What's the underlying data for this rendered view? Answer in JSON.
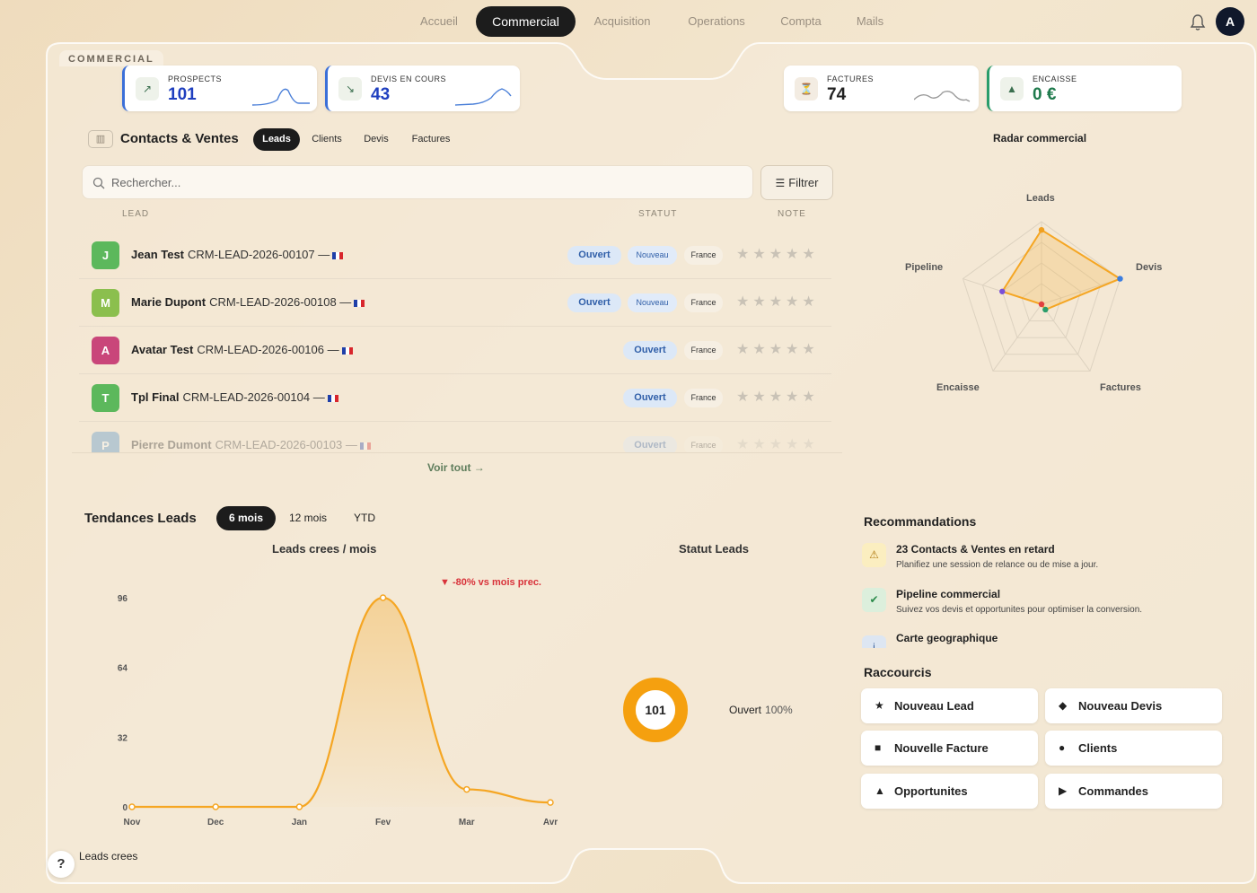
{
  "nav": {
    "tabs": [
      {
        "label": "Accueil"
      },
      {
        "label": "Commercial"
      },
      {
        "label": "Acquisition"
      },
      {
        "label": "Operations"
      },
      {
        "label": "Compta"
      },
      {
        "label": "Mails"
      }
    ],
    "active_tab": "Commercial",
    "avatar_initial": "A",
    "bell_icon": "bell-icon"
  },
  "section_tag": "COMMERCIAL",
  "kpis": [
    {
      "label": "PROSPECTS",
      "value": "101",
      "icon": "trend-up-icon",
      "color": "#1f3fbf"
    },
    {
      "label": "DEVIS EN COURS",
      "value": "43",
      "icon": "trend-down-icon",
      "color": "#1f3fbf"
    },
    {
      "label": "FACTURES",
      "value": "74",
      "icon": "hourglass-icon",
      "color": "#222222"
    },
    {
      "label": "ENCAISSE",
      "value": "0 €",
      "icon": "triangle-icon",
      "color": "#1e7a4c"
    }
  ],
  "contacts": {
    "title": "Contacts & Ventes",
    "tabs": [
      "Leads",
      "Clients",
      "Devis",
      "Factures"
    ],
    "active_tab": "Leads",
    "search_placeholder": "Rechercher...",
    "filter_label": "Filtrer",
    "columns": {
      "lead": "LEAD",
      "statut": "STATUT",
      "note": "NOTE"
    },
    "rows": [
      {
        "initial": "J",
        "color": "#5cb85c",
        "name": "Jean Test",
        "id": "CRM-LEAD-2026-00107 —",
        "status": "Ouvert",
        "tag": "Nouveau",
        "country": "France"
      },
      {
        "initial": "M",
        "color": "#8bbf4e",
        "name": "Marie Dupont",
        "id": "CRM-LEAD-2026-00108 —",
        "status": "Ouvert",
        "tag": "Nouveau",
        "country": "France"
      },
      {
        "initial": "A",
        "color": "#c9467a",
        "name": "Avatar Test",
        "id": "CRM-LEAD-2026-00106 —",
        "status": "Ouvert",
        "tag": "",
        "country": "France"
      },
      {
        "initial": "T",
        "color": "#5cb85c",
        "name": "Tpl Final",
        "id": "CRM-LEAD-2026-00104 —",
        "status": "Ouvert",
        "tag": "",
        "country": "France"
      },
      {
        "initial": "P",
        "color": "#4a8fc9",
        "name": "Pierre Dumont",
        "id": "CRM-LEAD-2026-00103 —",
        "status": "Ouvert",
        "tag": "",
        "country": "France"
      }
    ],
    "stars": "★★★★★",
    "voir_tout": "Voir tout →"
  },
  "radar": {
    "title": "Radar commercial",
    "axes": [
      "Leads",
      "Devis",
      "Factures",
      "Encaisse",
      "Pipeline"
    ],
    "values": [
      0.9,
      1.0,
      0.08,
      0.0,
      0.5
    ],
    "point_colors": [
      "#f0a020",
      "#3b7de0",
      "#2a9d6b",
      "#e04040",
      "#7a4fd8"
    ]
  },
  "trends": {
    "title": "Tendances Leads",
    "tabs": [
      "6 mois",
      "12 mois",
      "YTD"
    ],
    "active_tab": "6 mois",
    "chart_title": "Leads crees / mois",
    "delta": "▼ -80% vs mois prec.",
    "legend": "Leads crees"
  },
  "chart_data": {
    "type": "area",
    "categories": [
      "Nov",
      "Dec",
      "Jan",
      "Fev",
      "Mar",
      "Avr"
    ],
    "series": [
      {
        "name": "Leads crees",
        "values": [
          0,
          0,
          0,
          96,
          8,
          2
        ]
      }
    ],
    "yticks": [
      0,
      32,
      64,
      96
    ],
    "ylim": [
      0,
      96
    ],
    "color": "#f5a623"
  },
  "statut": {
    "title": "Statut Leads",
    "total": "101",
    "label": "Ouvert",
    "pct": "100%",
    "color": "#f5a00f"
  },
  "recommendations": {
    "title": "Recommandations",
    "items": [
      {
        "icon": "warning-icon",
        "title": "23 Contacts & Ventes en retard",
        "desc": "Planifiez une session de relance ou de mise a jour."
      },
      {
        "icon": "check-icon",
        "title": "Pipeline commercial",
        "desc": "Suivez vos devis et opportunites pour optimiser la conversion."
      },
      {
        "icon": "map-icon",
        "title": "Carte geographique",
        "desc": ""
      }
    ]
  },
  "shortcuts": {
    "title": "Raccourcis",
    "items": [
      {
        "icon": "★",
        "label": "Nouveau Lead"
      },
      {
        "icon": "◆",
        "label": "Nouveau Devis"
      },
      {
        "icon": "■",
        "label": "Nouvelle Facture"
      },
      {
        "icon": "●",
        "label": "Clients"
      },
      {
        "icon": "▲",
        "label": "Opportunites"
      },
      {
        "icon": "▶",
        "label": "Commandes"
      }
    ]
  },
  "help_label": "?"
}
